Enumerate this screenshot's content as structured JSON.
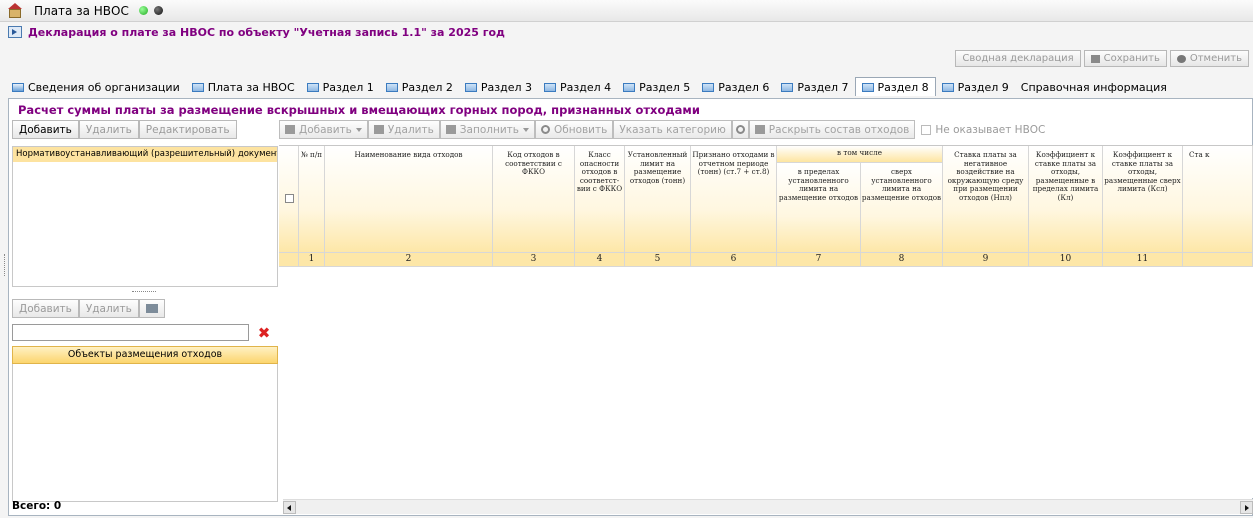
{
  "app": {
    "title": "Плата за НВОС"
  },
  "declaration": {
    "title": "Декларация о плате за НВОС по объекту \"Учетная запись 1.1\" за 2025 год"
  },
  "top_actions": {
    "summary": "Сводная декларация",
    "save": "Сохранить",
    "cancel": "Отменить"
  },
  "tabs": [
    {
      "label": "Сведения об организации",
      "active": false
    },
    {
      "label": "Плата за НВОС",
      "active": false
    },
    {
      "label": "Раздел 1",
      "active": false
    },
    {
      "label": "Раздел 2",
      "active": false
    },
    {
      "label": "Раздел 3",
      "active": false
    },
    {
      "label": "Раздел 4",
      "active": false
    },
    {
      "label": "Раздел 5",
      "active": false
    },
    {
      "label": "Раздел 6",
      "active": false
    },
    {
      "label": "Раздел 7",
      "active": false
    },
    {
      "label": "Раздел 8",
      "active": true
    },
    {
      "label": "Раздел 9",
      "active": false
    },
    {
      "label": "Справочная информация",
      "active": false
    }
  ],
  "section": {
    "title": "Расчет суммы платы за размещение вскрышных и вмещающих горных пород, признанных отходами"
  },
  "left_toolbar": {
    "add": "Добавить",
    "delete": "Удалить",
    "edit": "Редактировать"
  },
  "left_list": {
    "items": [
      "Нормативоустанавливающий (разрешительный) документ"
    ]
  },
  "left_toolbar2": {
    "add": "Добавить",
    "delete": "Удалить"
  },
  "left_search": {
    "value": ""
  },
  "left_list2": {
    "header": "Объекты размещения отходов"
  },
  "total": {
    "label": "Всего: 0"
  },
  "grid_toolbar": {
    "add": "Добавить",
    "delete": "Удалить",
    "fill": "Заполнить",
    "refresh": "Обновить",
    "category": "Указать категорию",
    "expand": "Раскрыть состав отходов",
    "no_impact": "Не оказывает НВОС"
  },
  "grid": {
    "headers": {
      "num": "№ п/п",
      "name": "Наименование вида отходов",
      "code": "Код отходов в соответствии с ФККО",
      "class": "Класс опасности отходов в соответст-вии с ФККО",
      "limit": "Установленный лимит на размещение отходов (тонн)",
      "recognized": "Признано отходами в отчетном периоде (тонн) (ст.7 + ст.8)",
      "including": "в том числе",
      "within": "в пределах установленного лимита на размещение отходов",
      "over": "сверх установленного лимита на размещение отходов",
      "rate": "Ставка платы за негативное воздействие на окружающую среду при размещении отходов (Нпл)",
      "coef_kl": "Коэффициент к ставке платы за отходы, размещенные в пределах лимита (Кл)",
      "coef_ksl": "Коэффициент к ставке платы за отходы, размещенные сверх лимита (Ксл)",
      "more": "Ста к"
    },
    "column_numbers": [
      "1",
      "2",
      "3",
      "4",
      "5",
      "6",
      "7",
      "8",
      "9",
      "10",
      "11"
    ]
  }
}
